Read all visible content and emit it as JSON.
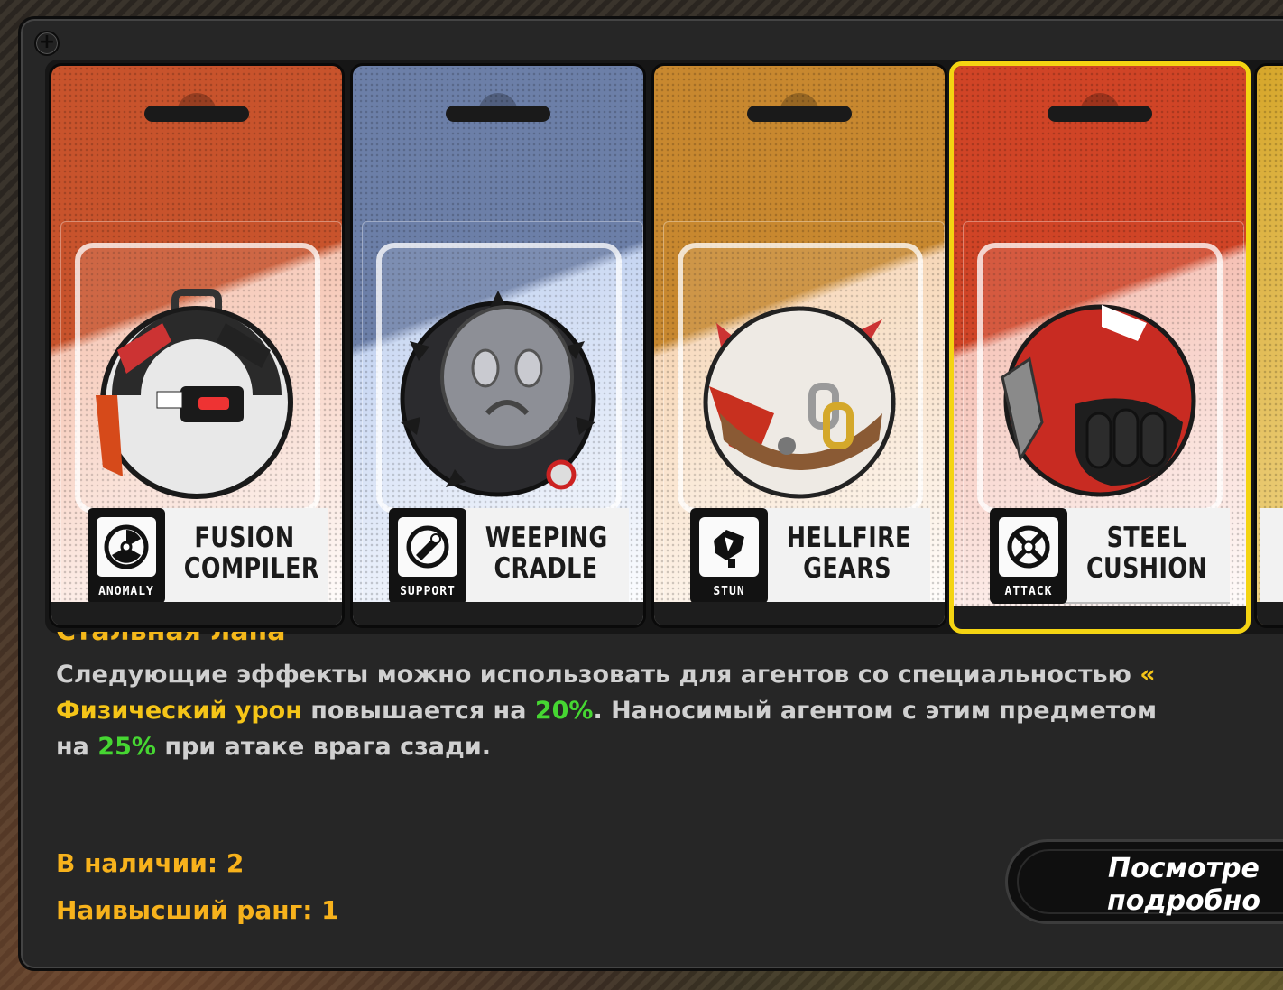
{
  "cards": [
    {
      "name_line1": "FUSION",
      "name_line2": "COMPILER",
      "tag": "ANOMALY",
      "icon": "anomaly-icon",
      "color": "#c8532c",
      "light": "#f6c7b5",
      "selected": false
    },
    {
      "name_line1": "WEEPING",
      "name_line2": "CRADLE",
      "tag": "SUPPORT",
      "icon": "support-icon",
      "color": "#6c7fa8",
      "light": "#c7d6f2",
      "selected": false
    },
    {
      "name_line1": "HELLFIRE",
      "name_line2": "GEARS",
      "tag": "STUN",
      "icon": "stun-icon",
      "color": "#c8882f",
      "light": "#f7d8b9",
      "selected": false
    },
    {
      "name_line1": "STEEL",
      "name_line2": "CUSHION",
      "tag": "ATTACK",
      "icon": "attack-icon",
      "color": "#d04426",
      "light": "#f6c2b6",
      "selected": true
    }
  ],
  "title_partial": "Стальная лапа",
  "description": {
    "l1_text": "Следующие эффекты можно использовать для агентов со специальностью ",
    "l1_hl": "«",
    "l2_hl": "Физический урон",
    "l2_text1": " повышается на ",
    "l2_pct": "20%",
    "l2_text2": ". Наносимый агентом с этим предметом ",
    "l3_text1": "на ",
    "l3_pct": "25%",
    "l3_text2": " при атаке врага сзади."
  },
  "stats": {
    "available": "В наличии: 2",
    "best_rank": "Наивысший ранг: 1"
  },
  "details_button": {
    "line1": "Посмотре",
    "line2": "подробно"
  }
}
